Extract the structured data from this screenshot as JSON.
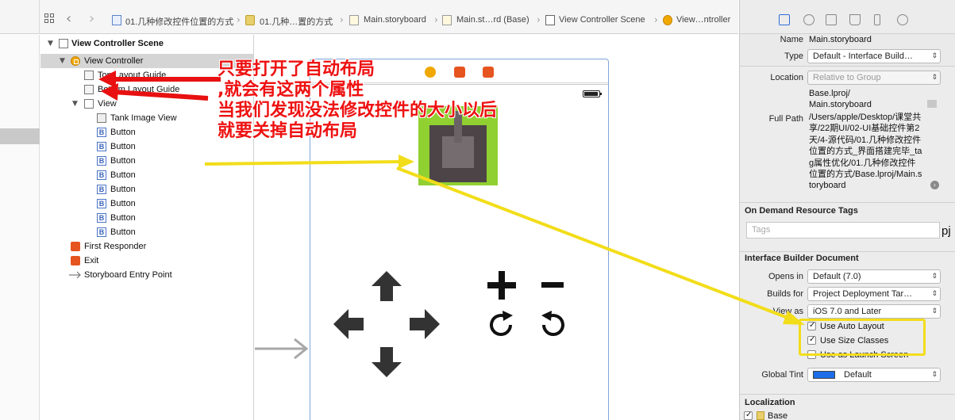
{
  "jumpbar": {
    "crumbs": [
      "01.几种修改控件位置的方式",
      "01.几种…置的方式",
      "Main.storyboard",
      "Main.st…rd (Base)",
      "View Controller Scene",
      "View…ntroller"
    ]
  },
  "outline": {
    "rows": [
      {
        "label": "View Controller Scene",
        "icon": "scene-icon"
      },
      {
        "label": "View Controller",
        "icon": "view-controller-icon"
      },
      {
        "label": "Top Layout Guide",
        "icon": "layout-guide-icon"
      },
      {
        "label": "Bottom Layout Guide",
        "icon": "layout-guide-icon"
      },
      {
        "label": "View",
        "icon": "view-icon"
      },
      {
        "label": "Tank Image View",
        "icon": "image-view-icon"
      },
      {
        "label": "Button",
        "icon": "button-icon"
      },
      {
        "label": "Button",
        "icon": "button-icon"
      },
      {
        "label": "Button",
        "icon": "button-icon"
      },
      {
        "label": "Button",
        "icon": "button-icon"
      },
      {
        "label": "Button",
        "icon": "button-icon"
      },
      {
        "label": "Button",
        "icon": "button-icon"
      },
      {
        "label": "Button",
        "icon": "button-icon"
      },
      {
        "label": "Button",
        "icon": "button-icon"
      },
      {
        "label": "First Responder",
        "icon": "cube-icon"
      },
      {
        "label": "Exit",
        "icon": "exit-icon"
      },
      {
        "label": "Storyboard Entry Point",
        "icon": "arrow-icon"
      }
    ]
  },
  "annotation": {
    "lines": [
      "只要打开了自动布局",
      ",就会有这两个属性",
      "当我们发现没法修改控件的大小以后",
      "就要关掉自动布局"
    ],
    "text_color": "#ee1111",
    "arrow_red": "#e81010",
    "arrow_yellow": "#f2dd1a"
  },
  "canvas": {
    "controls": {
      "up": "▲",
      "down": "▼",
      "left": "◀",
      "right": "▶",
      "plus": "+",
      "minus": "−",
      "rotate_left": "↻",
      "rotate_right": "↺"
    },
    "tank_bg_color": "#90d030"
  },
  "inspector": {
    "identity": {
      "name_label": "Name",
      "name_value": "Main.storyboard",
      "type_label": "Type",
      "type_value": "Default - Interface Build…",
      "location_label": "Location",
      "location_value": "Relative to Group",
      "location_file": "Base.lproj/\nMain.storyboard",
      "fullpath_label": "Full Path",
      "fullpath_value": "/Users/apple/Desktop/课堂共享/22期UI/02-UI基础控件第2天/4-源代码/01.几种修改控件位置的方式_界面搭建完毕_tag属性优化/01.几种修改控件位置的方式/Base.lproj/Main.storyboard"
    },
    "tags": {
      "title": "On Demand Resource Tags",
      "placeholder": "Tags"
    },
    "ibdoc": {
      "title": "Interface Builder Document",
      "opens_in_label": "Opens in",
      "opens_in_value": "Default (7.0)",
      "builds_for_label": "Builds for",
      "builds_for_value": "Project Deployment Tar…",
      "view_as_label": "View as",
      "view_as_value": "iOS 7.0 and Later",
      "auto_layout": "Use Auto Layout",
      "auto_layout_checked": true,
      "size_classes": "Use Size Classes",
      "size_classes_checked": true,
      "launch_screen": "Use as Launch Screen",
      "launch_screen_checked": false,
      "tint_label": "Global Tint",
      "tint_value": "Default",
      "tint_color": "#1c6ee8"
    },
    "localization": {
      "title": "Localization",
      "base_label": "Base",
      "base_checked": true
    }
  },
  "side_clip": "pj"
}
